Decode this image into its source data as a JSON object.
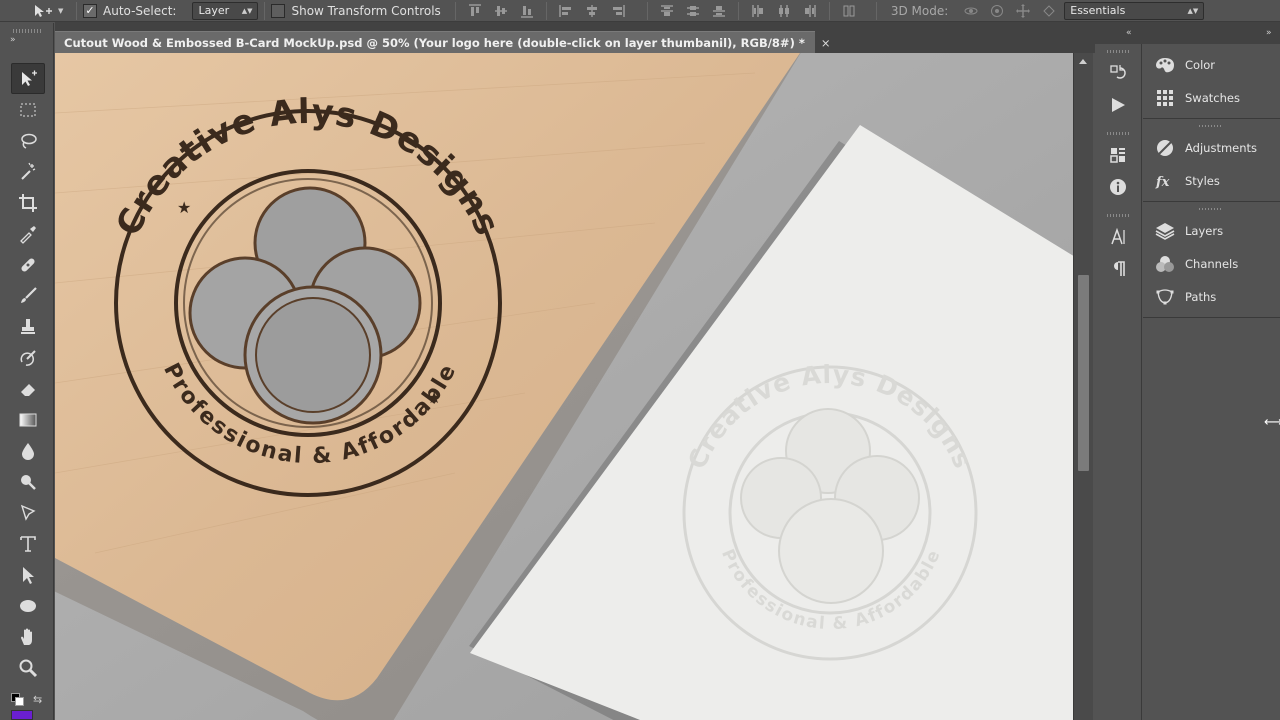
{
  "options_bar": {
    "auto_select_label": "Auto-Select:",
    "auto_select_checked": true,
    "auto_select_target": "Layer",
    "show_transform_label": "Show Transform Controls",
    "show_transform_checked": false,
    "mode_3d_label": "3D Mode:",
    "workspace": "Essentials"
  },
  "document": {
    "tab_title": "Cutout Wood & Embossed  B-Card MockUp.psd @ 50% (Your logo here (double-click on layer thumbanil), RGB/8#) *",
    "close_glyph": "×"
  },
  "canvas": {
    "logo_top_text": "Creative Alys Designs",
    "logo_bottom_text": "Professional & Affordable",
    "star": "★"
  },
  "panels": {
    "group1": [
      {
        "label": "Color",
        "icon": "color-palette-icon"
      },
      {
        "label": "Swatches",
        "icon": "swatches-grid-icon"
      }
    ],
    "group2": [
      {
        "label": "Adjustments",
        "icon": "adjustments-icon"
      },
      {
        "label": "Styles",
        "icon": "styles-fx-icon"
      }
    ],
    "group3": [
      {
        "label": "Layers",
        "icon": "layers-icon"
      },
      {
        "label": "Channels",
        "icon": "channels-icon"
      },
      {
        "label": "Paths",
        "icon": "paths-icon"
      }
    ]
  },
  "colors": {
    "foreground": "#000000",
    "background": "#ffffff",
    "accent_chip": "#6a1fd0"
  }
}
